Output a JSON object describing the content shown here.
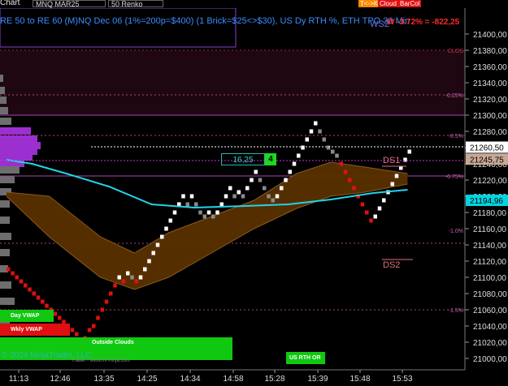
{
  "toolbar": {
    "menu_label": "Chart",
    "instrument": "MNQ MAR25",
    "bar_type": "50 Renko",
    "buttons": [
      {
        "label": "T<->K",
        "color": "#ff8a00"
      },
      {
        "label": "Cloud",
        "color": "#e01010"
      },
      {
        "label": "BarCol",
        "color": "#e01010"
      }
    ]
  },
  "info_line": "RE 50 to RE 60 (M)NQ Dec 06 (1%=200p=$400) (1 Brick=$25<>$30), US Dy RTH %, ETH TPO 30 Min",
  "ws2_label": "WS2",
  "pnl_label": "W -3.72% = -822,25",
  "price_axis": {
    "labels": [
      "21400,00",
      "21380,00",
      "21360,00",
      "21340,00",
      "21320,00",
      "21300,00",
      "21280,00",
      "21260,00",
      "21240,00",
      "21220,00",
      "21200,00",
      "21180,00",
      "21160,00",
      "21140,00",
      "21120,00",
      "21100,00",
      "21080,00",
      "21060,00",
      "21040,00",
      "21020,00",
      "21000,00"
    ],
    "markers": [
      {
        "text": "21260,50",
        "bg": "#ffffff",
        "fg": "#000000"
      },
      {
        "text": "21245,75",
        "bg": "#c8a894",
        "fg": "#000000"
      },
      {
        "text": "21194,96",
        "bg": "#00d6e0",
        "fg": "#000000"
      }
    ]
  },
  "time_axis": [
    "11:13",
    "12:46",
    "13:35",
    "14:25",
    "14:34",
    "14:58",
    "15:28",
    "15:39",
    "15:48",
    "15:53"
  ],
  "pct_levels": [
    {
      "text": "CLOS",
      "color": "#cc3355"
    },
    {
      "text": "-0.25%",
      "color": "#cc66aa"
    },
    {
      "text": "-0.5%",
      "color": "#cc66aa"
    },
    {
      "text": "-0.75%",
      "color": "#cc66aa"
    },
    {
      "text": "-1.0%",
      "color": "#cc66aa"
    },
    {
      "text": "-1.5%",
      "color": "#cc66aa"
    }
  ],
  "annotations": {
    "box_value": "16,25",
    "box_green": "4",
    "ds1": "DS1",
    "ds2": "DS2",
    "day_vwap": "Day VWAP",
    "wkly_vwap": "Wkly VWAP",
    "outside_clouds": "Outside Clouds",
    "us_rth_or": "US RTH OR",
    "copyright": "© 2024 NinjaTrader, LLC",
    "copyright_small": "Trader - www.mr-ninja.com"
  },
  "chart_data": {
    "type": "renko",
    "brick_size": 5,
    "y_range": [
      20990,
      21410
    ],
    "bricks": [
      {
        "p": 21110,
        "c": "red"
      },
      {
        "p": 21105,
        "c": "red"
      },
      {
        "p": 21100,
        "c": "red"
      },
      {
        "p": 21095,
        "c": "red"
      },
      {
        "p": 21090,
        "c": "red"
      },
      {
        "p": 21085,
        "c": "red"
      },
      {
        "p": 21080,
        "c": "red"
      },
      {
        "p": 21075,
        "c": "red"
      },
      {
        "p": 21070,
        "c": "red"
      },
      {
        "p": 21065,
        "c": "red"
      },
      {
        "p": 21060,
        "c": "red"
      },
      {
        "p": 21055,
        "c": "red"
      },
      {
        "p": 21050,
        "c": "red"
      },
      {
        "p": 21045,
        "c": "red"
      },
      {
        "p": 21040,
        "c": "red"
      },
      {
        "p": 21035,
        "c": "red"
      },
      {
        "p": 21030,
        "c": "red"
      },
      {
        "p": 21020,
        "c": "red"
      },
      {
        "p": 21025,
        "c": "red"
      },
      {
        "p": 21035,
        "c": "red"
      },
      {
        "p": 21040,
        "c": "red"
      },
      {
        "p": 21050,
        "c": "red"
      },
      {
        "p": 21060,
        "c": "red"
      },
      {
        "p": 21070,
        "c": "red"
      },
      {
        "p": 21080,
        "c": "red"
      },
      {
        "p": 21090,
        "c": "red"
      },
      {
        "p": 21100,
        "c": "white"
      },
      {
        "p": 21095,
        "c": "red"
      },
      {
        "p": 21105,
        "c": "white"
      },
      {
        "p": 21100,
        "c": "gray"
      },
      {
        "p": 21095,
        "c": "red"
      },
      {
        "p": 21100,
        "c": "white"
      },
      {
        "p": 21110,
        "c": "white"
      },
      {
        "p": 21120,
        "c": "white"
      },
      {
        "p": 21130,
        "c": "white"
      },
      {
        "p": 21140,
        "c": "white"
      },
      {
        "p": 21150,
        "c": "white"
      },
      {
        "p": 21160,
        "c": "white"
      },
      {
        "p": 21170,
        "c": "white"
      },
      {
        "p": 21180,
        "c": "white"
      },
      {
        "p": 21190,
        "c": "white"
      },
      {
        "p": 21200,
        "c": "white"
      },
      {
        "p": 21190,
        "c": "gray"
      },
      {
        "p": 21200,
        "c": "white"
      },
      {
        "p": 21190,
        "c": "gray"
      },
      {
        "p": 21180,
        "c": "gray"
      },
      {
        "p": 21175,
        "c": "gray"
      },
      {
        "p": 21180,
        "c": "white"
      },
      {
        "p": 21175,
        "c": "gray"
      },
      {
        "p": 21180,
        "c": "white"
      },
      {
        "p": 21190,
        "c": "white"
      },
      {
        "p": 21200,
        "c": "white"
      },
      {
        "p": 21210,
        "c": "white"
      },
      {
        "p": 21200,
        "c": "gray"
      },
      {
        "p": 21205,
        "c": "white"
      },
      {
        "p": 21200,
        "c": "gray"
      },
      {
        "p": 21210,
        "c": "white"
      },
      {
        "p": 21220,
        "c": "white"
      },
      {
        "p": 21230,
        "c": "white"
      },
      {
        "p": 21220,
        "c": "gray"
      },
      {
        "p": 21210,
        "c": "gray"
      },
      {
        "p": 21200,
        "c": "gray"
      },
      {
        "p": 21195,
        "c": "gray"
      },
      {
        "p": 21200,
        "c": "white"
      },
      {
        "p": 21210,
        "c": "white"
      },
      {
        "p": 21220,
        "c": "white"
      },
      {
        "p": 21230,
        "c": "white"
      },
      {
        "p": 21240,
        "c": "white"
      },
      {
        "p": 21250,
        "c": "white"
      },
      {
        "p": 21260,
        "c": "white"
      },
      {
        "p": 21270,
        "c": "white"
      },
      {
        "p": 21280,
        "c": "white"
      },
      {
        "p": 21290,
        "c": "white"
      },
      {
        "p": 21280,
        "c": "gray"
      },
      {
        "p": 21270,
        "c": "gray"
      },
      {
        "p": 21260,
        "c": "gray"
      },
      {
        "p": 21255,
        "c": "gray"
      },
      {
        "p": 21250,
        "c": "gray"
      },
      {
        "p": 21240,
        "c": "red"
      },
      {
        "p": 21230,
        "c": "red"
      },
      {
        "p": 21220,
        "c": "red"
      },
      {
        "p": 21210,
        "c": "red"
      },
      {
        "p": 21200,
        "c": "red"
      },
      {
        "p": 21190,
        "c": "red"
      },
      {
        "p": 21180,
        "c": "red"
      },
      {
        "p": 21170,
        "c": "red"
      },
      {
        "p": 21175,
        "c": "white"
      },
      {
        "p": 21185,
        "c": "white"
      },
      {
        "p": 21195,
        "c": "white"
      },
      {
        "p": 21205,
        "c": "white"
      },
      {
        "p": 21215,
        "c": "white"
      },
      {
        "p": 21225,
        "c": "white"
      },
      {
        "p": 21235,
        "c": "white"
      },
      {
        "p": 21245,
        "c": "white"
      },
      {
        "p": 21255,
        "c": "white"
      }
    ],
    "cyan_line": [
      {
        "i": 0,
        "p": 21245
      },
      {
        "i": 6,
        "p": 21240
      },
      {
        "i": 14,
        "p": 21228
      },
      {
        "i": 24,
        "p": 21212
      },
      {
        "i": 34,
        "p": 21190
      },
      {
        "i": 44,
        "p": 21186
      },
      {
        "i": 56,
        "p": 21188
      },
      {
        "i": 66,
        "p": 21190
      },
      {
        "i": 76,
        "p": 21196
      },
      {
        "i": 86,
        "p": 21204
      },
      {
        "i": 94,
        "p": 21208
      }
    ],
    "cloud_upper": [
      {
        "i": 0,
        "p": 21205
      },
      {
        "i": 10,
        "p": 21200
      },
      {
        "i": 22,
        "p": 21150
      },
      {
        "i": 30,
        "p": 21130
      },
      {
        "i": 38,
        "p": 21155
      },
      {
        "i": 48,
        "p": 21175
      },
      {
        "i": 58,
        "p": 21195
      },
      {
        "i": 68,
        "p": 21228
      },
      {
        "i": 76,
        "p": 21242
      },
      {
        "i": 84,
        "p": 21236
      },
      {
        "i": 94,
        "p": 21228
      }
    ],
    "cloud_lower": [
      {
        "i": 0,
        "p": 21200
      },
      {
        "i": 10,
        "p": 21150
      },
      {
        "i": 22,
        "p": 21100
      },
      {
        "i": 30,
        "p": 21085
      },
      {
        "i": 38,
        "p": 21100
      },
      {
        "i": 48,
        "p": 21130
      },
      {
        "i": 58,
        "p": 21160
      },
      {
        "i": 68,
        "p": 21185
      },
      {
        "i": 76,
        "p": 21200
      },
      {
        "i": 84,
        "p": 21205
      },
      {
        "i": 94,
        "p": 21215
      }
    ]
  }
}
